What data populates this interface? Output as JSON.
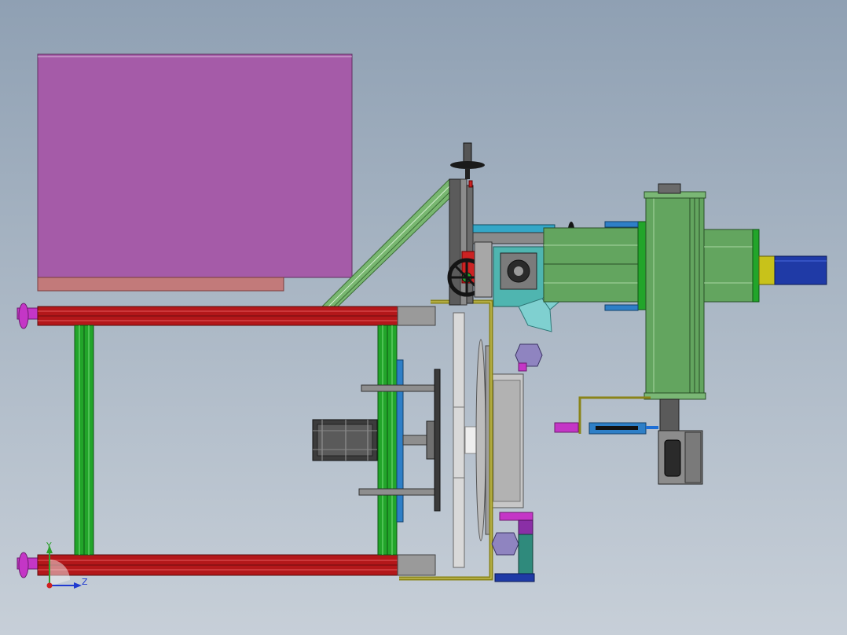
{
  "colors": {
    "background_top": "#8fa0b3",
    "background_bottom": "#c7cfd8",
    "hopper": "#a55ba8",
    "hopper_base": "#c27a7a",
    "frame_rail": "#b3171a",
    "frame_post": "#22a52a",
    "leveling_foot": "#c436c6",
    "strut": "#78b770",
    "spindle_housing": "#63a55f",
    "spindle_motor": "#1f3aa6",
    "motor_adapter": "#c8c21a",
    "gear_box": "#4fb5b0",
    "nozzle": "#7fd0d0",
    "plate_blue": "#2e7fc7",
    "disc": "#d9d9d9",
    "bracket_olive": "#8a8418",
    "purple_valve": "#8f84c0",
    "teal_block": "#2f8a7c",
    "dark_steel": "#3c3c3c",
    "axis_x": "#2ca02c",
    "axis_y": "#2ca02c",
    "axis_z": "#1f3ad0",
    "origin": "#d01f1f"
  },
  "triad": {
    "y_label": "Y",
    "z_label": "Z"
  }
}
